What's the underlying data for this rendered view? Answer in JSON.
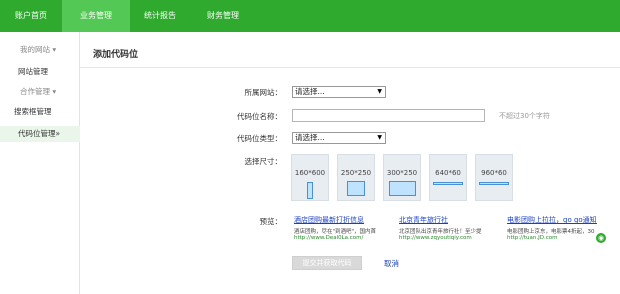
{
  "topnav": {
    "items": [
      "账户首页",
      "业务管理",
      "统计报告",
      "财务管理"
    ]
  },
  "sidebar": {
    "items": [
      "我的网站 ▾",
      "网站管理",
      "合作管理 ▾",
      "搜索框管理",
      "代码位管理»"
    ]
  },
  "page": {
    "title": "添加代码位"
  },
  "form": {
    "site_label": "所属网站：",
    "site_value": "请选择...",
    "name_label": "代码位名称：",
    "name_value": "",
    "name_hint": "不超过30个字符",
    "type_label": "代码位类型：",
    "type_value": "请选择...",
    "size_label": "选择尺寸：",
    "sizes": [
      "160*600",
      "250*250",
      "300*250",
      "640*60",
      "960*60"
    ],
    "preview_label": "预览：",
    "submit_label": "提交并获取代码",
    "cancel_label": "取消"
  },
  "preview_ads": [
    {
      "title": "酒店团购最新打折信息",
      "desc": "酒店团购，尽在\"到酒吧\"，国内首",
      "url": "http://www.Deal0La.com/"
    },
    {
      "title": "北京青年旅行社",
      "desc": "北京团队出京青年旅行社！至少提",
      "url": "http://www.zqyoutiqiy.com"
    },
    {
      "title": "电影团购上拉拉，go go通知！",
      "desc": "电影团购上京东，电影票4折起，30",
      "url": "http://tuan.JD.com"
    }
  ],
  "colors": {
    "topbar": "#2faa2f",
    "topbar_active": "#54c854",
    "link": "#1a3fc4",
    "sidebar_active": "#e9f6e9"
  }
}
